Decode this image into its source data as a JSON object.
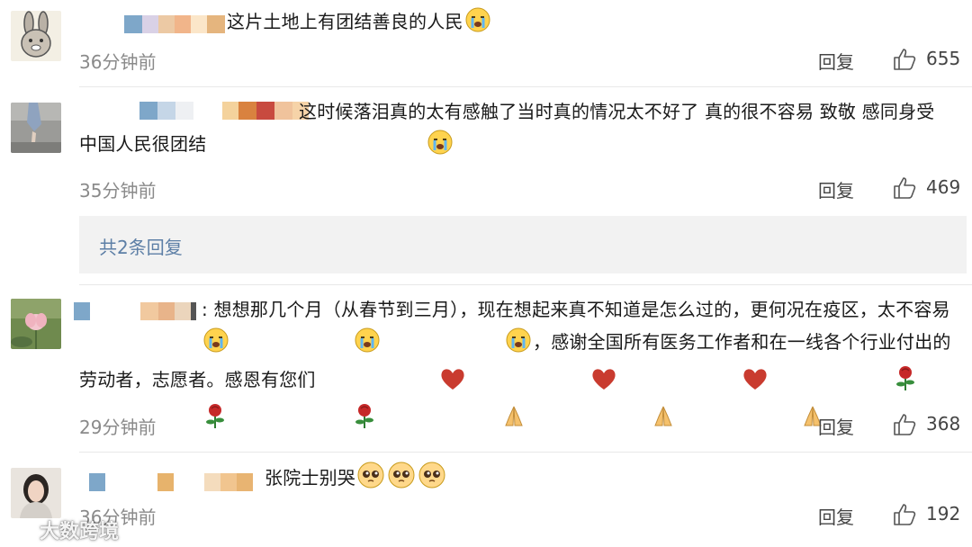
{
  "actions": {
    "reply_label": "回复"
  },
  "comments": [
    {
      "text": "这片土地上有团结善良的人民",
      "emojis": [
        "crying-emoji"
      ],
      "time": "36分钟前",
      "likes": "655"
    },
    {
      "text": "这时候落泪真的太有感触了当时真的情况太不好了 真的很不容易 致敬 感同身受 中国人民很团结",
      "emojis": [
        "crying-emoji"
      ],
      "time": "35分钟前",
      "likes": "469",
      "replies_label": "共2条回复"
    },
    {
      "prefix": ":",
      "text_line1": "想想那几个月（从春节到三月），现在想起来真不知道是怎么过的，更何况在疫",
      "text_line2": "区，太不容易",
      "text_line2b": "，感谢全国所有医务工作者和在一线各个行业付出的劳动者，志愿者。感",
      "text_line3": "恩有您们",
      "emojis_a": [
        "crying-emoji",
        "crying-emoji",
        "crying-emoji"
      ],
      "emojis_b": [
        "heart-emoji",
        "heart-emoji",
        "heart-emoji",
        "rose-emoji",
        "rose-emoji",
        "rose-emoji",
        "pray-emoji",
        "pray-emoji",
        "pray-emoji"
      ],
      "time": "29分钟前",
      "likes": "368"
    },
    {
      "text": "张院士别哭",
      "emojis": [
        "pleading-emoji",
        "pleading-emoji",
        "pleading-emoji"
      ],
      "time": "36分钟前",
      "likes": "192"
    }
  ],
  "watermark": {
    "text": "大数跨境"
  },
  "colors": {
    "link": "#5d7fa6",
    "meta": "#8a8a8a",
    "reply_bg": "#f2f2f2"
  }
}
